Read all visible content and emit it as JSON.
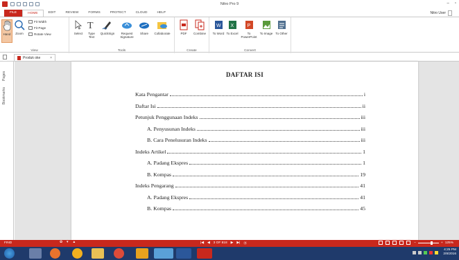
{
  "window": {
    "title": "Nitro Pro 9"
  },
  "ribbon": {
    "tabs": [
      "FILE",
      "HOME",
      "EDIT",
      "REVIEW",
      "FORMS",
      "PROTECT",
      "CLOUD",
      "HELP"
    ],
    "user_label": "Nitro User",
    "view": {
      "group_label": "View",
      "hand": "Hand",
      "zoom": "Zoom",
      "fit_width": "Fit Width",
      "fit_page": "Fit Page",
      "rotate_view": "Rotate View"
    },
    "tools": {
      "group_label": "Tools",
      "select": "Select",
      "type_text": "Type Text",
      "quicksign": "QuickSign",
      "request_signature": "Request Signature",
      "share": "Share",
      "collaborate": "Collaborate"
    },
    "create": {
      "group_label": "Create",
      "pdf": "PDF",
      "combine": "Combine"
    },
    "convert": {
      "group_label": "Convert",
      "to_word": "To Word",
      "to_excel": "To Excel",
      "to_powerpoint": "To PowerPoint",
      "to_image": "To Image",
      "to_other": "To Other"
    }
  },
  "document": {
    "tab_name": "Produk oke"
  },
  "side_panel": {
    "bookmarks": "Bookmarks",
    "pages": "Pages"
  },
  "page": {
    "heading": "DAFTAR ISI",
    "toc": [
      {
        "label": "Kata Pengantar",
        "page": "i",
        "level": 0
      },
      {
        "label": "Daftar Isi",
        "page": "ii",
        "level": 0
      },
      {
        "label": "Petunjuk Penggunaan Indeks",
        "page": "iii",
        "level": 0
      },
      {
        "label": "A. Penyusunan Indeks",
        "page": "iii",
        "level": 1
      },
      {
        "label": "B. Cara Penelusuran Indeks",
        "page": "iii",
        "level": 1
      },
      {
        "label": "Indeks Artikel",
        "page": "1",
        "level": 0
      },
      {
        "label": "A. Padang Ekspres",
        "page": "1",
        "level": 1
      },
      {
        "label": "B. Kompas",
        "page": "19",
        "level": 1
      },
      {
        "label": "Indeks Pengarang",
        "page": "41",
        "level": 0
      },
      {
        "label": "A. Padang Ekspres",
        "page": "41",
        "level": 1
      },
      {
        "label": "B. Kompas",
        "page": "45",
        "level": 1
      }
    ]
  },
  "statusbar": {
    "find": "FIND",
    "page_indicator": "3 OF 818",
    "zoom_level": "125%"
  },
  "taskbar": {
    "time": "4:25 PM",
    "date": "2/8/2016"
  },
  "colors": {
    "accent": "#c8281d",
    "taskbar": "#1f3a6b",
    "hand_highlight": "#f3c7a3"
  }
}
